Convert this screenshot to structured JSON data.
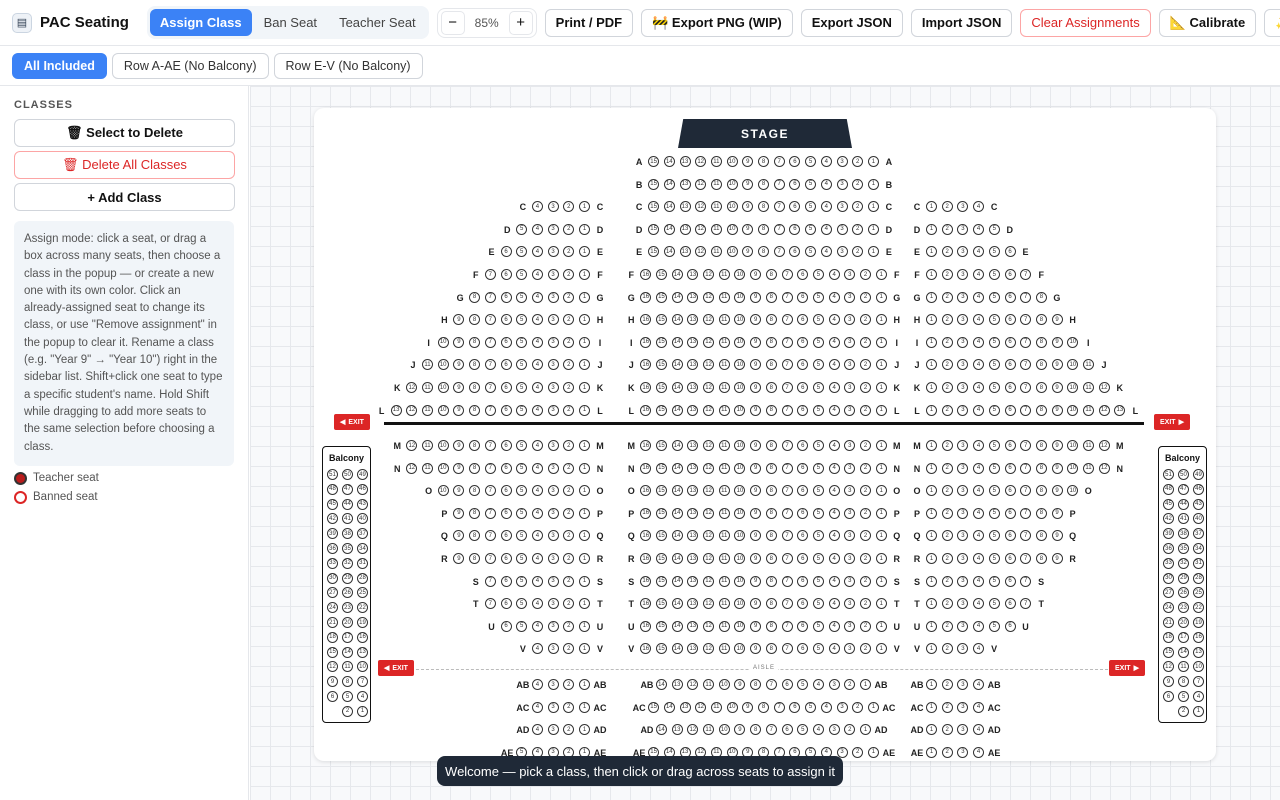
{
  "app": {
    "title": "PAC Seating",
    "logo_icon": "theatre-icon"
  },
  "modes": [
    {
      "label": "Assign Class",
      "active": true
    },
    {
      "label": "Ban Seat",
      "active": false
    },
    {
      "label": "Teacher Seat",
      "active": false
    }
  ],
  "zoom": {
    "minus": "−",
    "value": "85%",
    "plus": "+"
  },
  "toolbar": {
    "print": "Print / PDF",
    "export_png": "🚧 Export PNG (WIP)",
    "export_json": "Export JSON",
    "import_json": "Import JSON",
    "clear": "Clear Assignments",
    "calibrate": "📐 Calibrate",
    "ai": "✨ AI"
  },
  "filters": [
    {
      "label": "All Included",
      "active": true
    },
    {
      "label": "Row A-AE (No Balcony)",
      "active": false
    },
    {
      "label": "Row E-V (No Balcony)",
      "active": false
    }
  ],
  "sidebar": {
    "title": "CLASSES",
    "select_delete": "🗑 Select to Delete",
    "delete_all": "🗑 Delete All Classes",
    "add_class": "+ Add Class",
    "help": "Assign mode: click a seat, or drag a box across many seats, then choose a class in the popup — or create a new one with its own color. Click an already-assigned seat to change its class, or use \"Remove assignment\" in the popup to clear it. Rename a class (e.g. \"Year 9\" → \"Year 10\") right in the sidebar list. Shift+click one seat to type a specific student's name. Hold Shift while dragging to add more seats to the same selection before choosing a class.",
    "legend": [
      {
        "label": "Teacher seat",
        "color": "#b91c1c",
        "filled": true
      },
      {
        "label": "Banned seat",
        "color": "#dc2626",
        "filled": false
      }
    ]
  },
  "stage": "STAGE",
  "aisle": "AISLE",
  "exit": "EXIT",
  "balcony": "Balcony",
  "balcony_rows": [
    [
      51,
      50,
      49
    ],
    [
      48,
      47,
      46
    ],
    [
      45,
      44,
      43
    ],
    [
      42,
      41,
      40
    ],
    [
      39,
      38,
      37
    ],
    [
      36,
      35,
      34
    ],
    [
      33,
      32,
      31
    ],
    [
      30,
      29,
      28
    ],
    [
      27,
      26,
      25
    ],
    [
      24,
      23,
      22
    ],
    [
      21,
      20,
      19
    ],
    [
      18,
      17,
      16
    ],
    [
      15,
      14,
      13
    ],
    [
      12,
      11,
      10
    ],
    [
      9,
      8,
      7
    ],
    [
      6,
      5,
      4
    ],
    [
      null,
      2,
      1
    ]
  ],
  "rows": [
    {
      "r": "A",
      "l": 0,
      "c": 15,
      "rr": 0
    },
    {
      "r": "B",
      "l": 0,
      "c": 15,
      "rr": 0
    },
    {
      "r": "C",
      "l": 4,
      "c": 15,
      "rr": 4
    },
    {
      "r": "D",
      "l": 5,
      "c": 15,
      "rr": 5
    },
    {
      "r": "E",
      "l": 6,
      "c": 15,
      "rr": 6
    },
    {
      "r": "F",
      "l": 7,
      "c": 16,
      "rr": 7
    },
    {
      "r": "G",
      "l": 8,
      "c": 16,
      "rr": 8
    },
    {
      "r": "H",
      "l": 9,
      "c": 16,
      "rr": 9
    },
    {
      "r": "I",
      "l": 10,
      "c": 16,
      "rr": 10
    },
    {
      "r": "J",
      "l": 11,
      "c": 16,
      "rr": 11
    },
    {
      "r": "K",
      "l": 12,
      "c": 16,
      "rr": 12
    },
    {
      "r": "L",
      "l": 13,
      "c": 16,
      "rr": 13
    },
    {
      "r": "M",
      "l": 12,
      "c": 16,
      "rr": 12
    },
    {
      "r": "N",
      "l": 12,
      "c": 16,
      "rr": 12
    },
    {
      "r": "O",
      "l": 10,
      "c": 16,
      "rr": 10
    },
    {
      "r": "P",
      "l": 9,
      "c": 16,
      "rr": 9
    },
    {
      "r": "Q",
      "l": 9,
      "c": 16,
      "rr": 9
    },
    {
      "r": "R",
      "l": 9,
      "c": 16,
      "rr": 9
    },
    {
      "r": "S",
      "l": 7,
      "c": 16,
      "rr": 7
    },
    {
      "r": "T",
      "l": 7,
      "c": 16,
      "rr": 7
    },
    {
      "r": "U",
      "l": 6,
      "c": 16,
      "rr": 6
    },
    {
      "r": "V",
      "l": 4,
      "c": 16,
      "rr": 4
    },
    {
      "r": "AB",
      "l": 4,
      "c": 14,
      "rr": 4
    },
    {
      "r": "AC",
      "l": 4,
      "c": 15,
      "rr": 4
    },
    {
      "r": "AD",
      "l": 4,
      "c": 14,
      "rr": 4
    },
    {
      "r": "AE",
      "l": 5,
      "c": 15,
      "rr": 4
    }
  ],
  "toast": "Welcome — pick a class, then click or drag across seats to assign it"
}
